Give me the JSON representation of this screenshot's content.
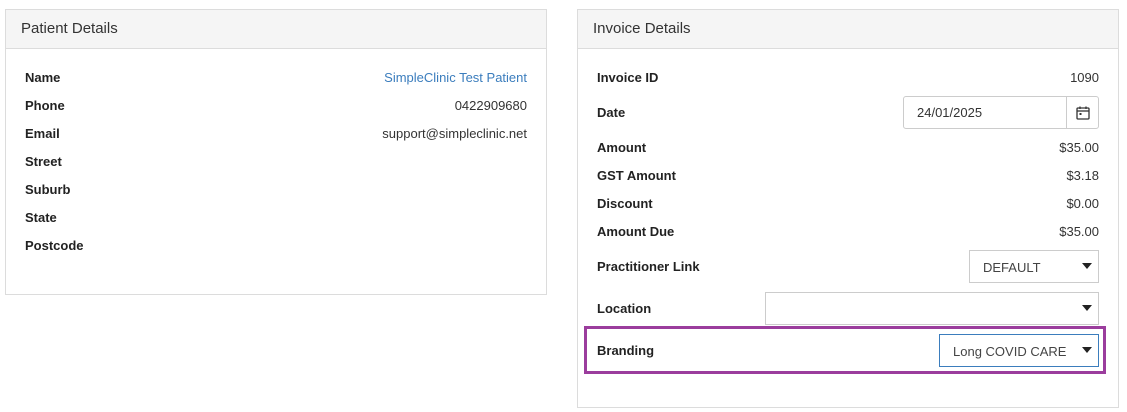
{
  "patient": {
    "heading": "Patient Details",
    "fields": [
      {
        "label": "Name",
        "value": "SimpleClinic Test Patient"
      },
      {
        "label": "Phone",
        "value": "0422909680"
      },
      {
        "label": "Email",
        "value": "support@simpleclinic.net"
      },
      {
        "label": "Street",
        "value": ""
      },
      {
        "label": "Suburb",
        "value": ""
      },
      {
        "label": "State",
        "value": ""
      },
      {
        "label": "Postcode",
        "value": ""
      }
    ]
  },
  "invoice": {
    "heading": "Invoice Details",
    "invoice_id": {
      "label": "Invoice ID",
      "value": "1090"
    },
    "date": {
      "label": "Date",
      "value": "24/01/2025"
    },
    "amount": {
      "label": "Amount",
      "value": "$35.00"
    },
    "gst": {
      "label": "GST Amount",
      "value": "$3.18"
    },
    "discount": {
      "label": "Discount",
      "value": "$0.00"
    },
    "amount_due": {
      "label": "Amount Due",
      "value": "$35.00"
    },
    "practitioner_link": {
      "label": "Practitioner Link",
      "value": "DEFAULT"
    },
    "location": {
      "label": "Location",
      "value": ""
    },
    "branding": {
      "label": "Branding",
      "value": "Long COVID CARE"
    }
  },
  "colors": {
    "link": "#3b7dbd",
    "highlight": "#9b3d9d",
    "panel_header": "#f5f5f5"
  },
  "icons": {
    "date_picker": "calendar-icon",
    "select": "caret-down-icon"
  }
}
